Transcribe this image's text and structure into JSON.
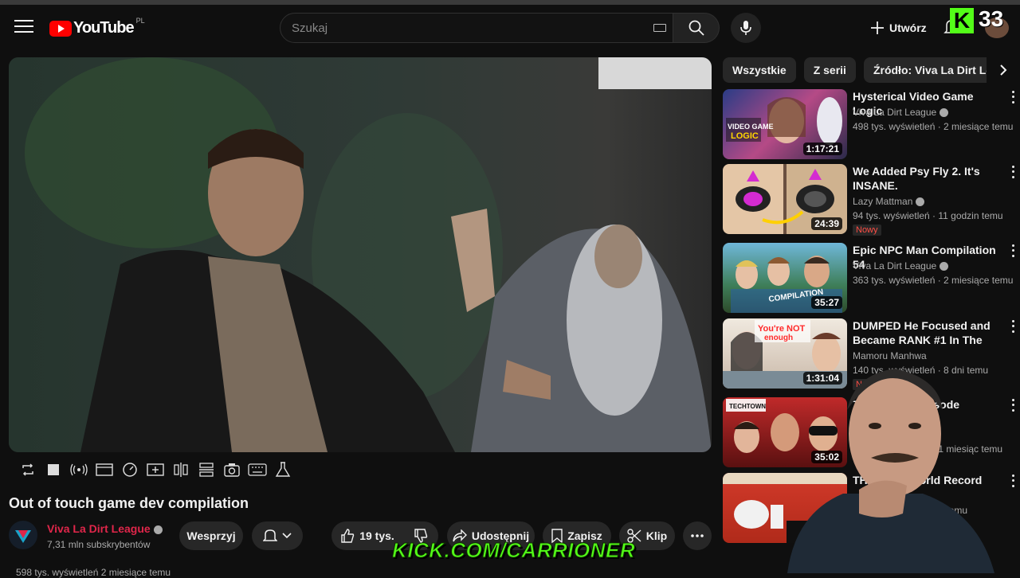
{
  "header": {
    "logo_text": "YouTube",
    "country_code": "PL",
    "search_placeholder": "Szukaj",
    "create_label": "Utwórz",
    "kick_letter": "K",
    "overlay_count": "33"
  },
  "video": {
    "title": "Out of touch game dev compilation",
    "channel": "Viva La Dirt League",
    "subscribers": "7,31 mln subskrybentów",
    "support_label": "Wesprzyj",
    "likes": "19 tys.",
    "share_label": "Udostępnij",
    "save_label": "Zapisz",
    "clip_label": "Klip",
    "description_peek": "598 tys. wyświetleń  2 miesiące temu"
  },
  "stream_overlay": {
    "kick_url": "KICK.COM/CARRIONER"
  },
  "chips": [
    "Wszystkie",
    "Z serii",
    "Źródło: Viva La Dirt League"
  ],
  "related": [
    {
      "title": "Hysterical Video Game Logic",
      "channel": "Viva La Dirt League",
      "verified": true,
      "meta": "498 tys. wyświetleń · 2 miesiące temu",
      "duration": "1:17:21",
      "badge": ""
    },
    {
      "title": "We Added Psy Fly 2. It's INSANE.",
      "channel": "Lazy Mattman",
      "verified": true,
      "meta": "94 tys. wyświetleń · 11 godzin temu",
      "duration": "24:39",
      "badge": "Nowy"
    },
    {
      "title": "Epic NPC Man Compilation 54",
      "channel": "Viva La Dirt League",
      "verified": true,
      "meta": "363 tys. wyświetleń · 2 miesiące temu",
      "duration": "35:27",
      "badge": ""
    },
    {
      "title": "DUMPED He Focused and Became RANK #1 In The Gam...",
      "channel": "Mamoru Manhwa",
      "verified": false,
      "meta": "140 tys. wyświetleń · 8 dni temu",
      "duration": "1:31:04",
      "badge": "Nowy"
    },
    {
      "title": "TechTown - Episode",
      "channel": "",
      "verified": false,
      "meta": "23 tys. wyświetleń · 1 miesiąc temu",
      "duration": "35:02",
      "badge": ""
    },
    {
      "title": "THE ... ER World Record",
      "channel": "",
      "verified": false,
      "meta": "... tys. wyświetleń · ... temu",
      "duration": "",
      "badge": ""
    }
  ],
  "colors": {
    "background": "#0f0f0f",
    "brand_red": "#ff0000",
    "kick_green": "#53fc18",
    "channel_name": "#e0264a"
  }
}
